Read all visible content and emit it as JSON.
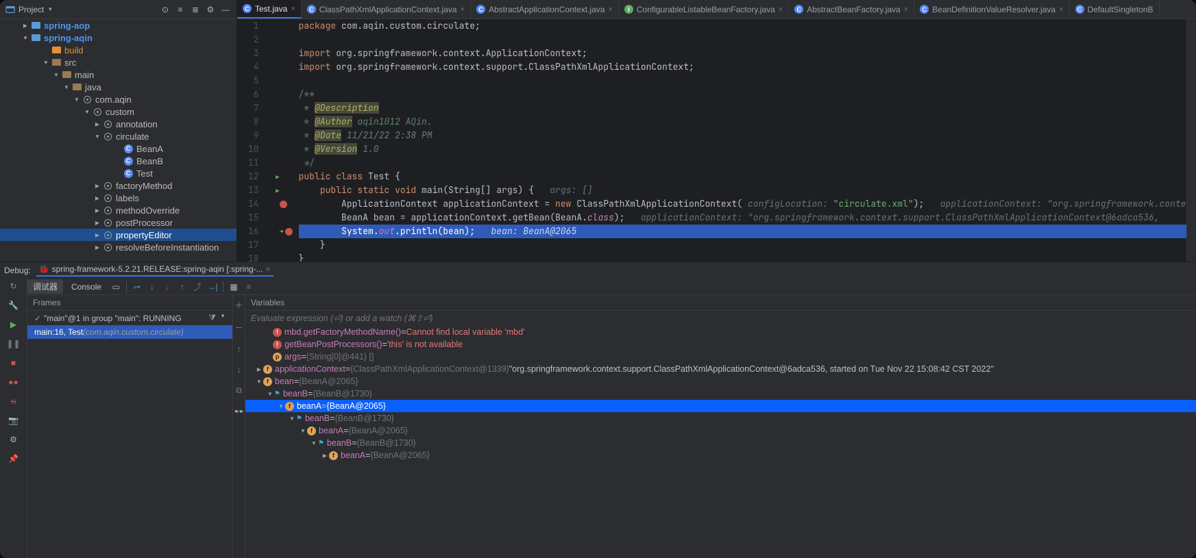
{
  "project": {
    "title": "Project",
    "tree": [
      {
        "indent": 30,
        "exp": "right",
        "icon": "module",
        "label": "spring-aop"
      },
      {
        "indent": 30,
        "exp": "down",
        "icon": "module",
        "label": "spring-aqin"
      },
      {
        "indent": 60,
        "exp": "",
        "icon": "build",
        "label": "build"
      },
      {
        "indent": 60,
        "exp": "down",
        "icon": "folder",
        "label": "src"
      },
      {
        "indent": 75,
        "exp": "down",
        "icon": "folder-src",
        "label": "main"
      },
      {
        "indent": 90,
        "exp": "down",
        "icon": "folder-src",
        "label": "java"
      },
      {
        "indent": 105,
        "exp": "down",
        "icon": "pkg",
        "label": "com.aqin"
      },
      {
        "indent": 120,
        "exp": "down",
        "icon": "pkg",
        "label": "custom"
      },
      {
        "indent": 135,
        "exp": "right",
        "icon": "pkg",
        "label": "annotation"
      },
      {
        "indent": 135,
        "exp": "down",
        "icon": "pkg",
        "label": "circulate"
      },
      {
        "indent": 165,
        "exp": "",
        "icon": "class",
        "label": "BeanA"
      },
      {
        "indent": 165,
        "exp": "",
        "icon": "class",
        "label": "BeanB"
      },
      {
        "indent": 165,
        "exp": "",
        "icon": "class",
        "label": "Test"
      },
      {
        "indent": 135,
        "exp": "right",
        "icon": "pkg",
        "label": "factoryMethod"
      },
      {
        "indent": 135,
        "exp": "right",
        "icon": "pkg",
        "label": "labels"
      },
      {
        "indent": 135,
        "exp": "right",
        "icon": "pkg",
        "label": "methodOverride"
      },
      {
        "indent": 135,
        "exp": "right",
        "icon": "pkg",
        "label": "postProcessor"
      },
      {
        "indent": 135,
        "exp": "right",
        "icon": "pkg",
        "label": "propertyEditor",
        "selected": true
      },
      {
        "indent": 135,
        "exp": "right",
        "icon": "pkg",
        "label": "resolveBeforeInstantiation"
      }
    ]
  },
  "tabs": [
    {
      "name": "Test.java",
      "active": true,
      "color": "#548af7"
    },
    {
      "name": "ClassPathXmlApplicationContext.java",
      "active": false,
      "color": "#548af7"
    },
    {
      "name": "AbstractApplicationContext.java",
      "active": false,
      "color": "#548af7"
    },
    {
      "name": "ConfigurableListableBeanFactory.java",
      "active": false,
      "color": "#5fad65"
    },
    {
      "name": "AbstractBeanFactory.java",
      "active": false,
      "color": "#548af7"
    },
    {
      "name": "BeanDefinitionValueResolver.java",
      "active": false,
      "color": "#548af7"
    },
    {
      "name": "DefaultSingletonB",
      "active": false,
      "color": "#548af7",
      "noclose": true
    }
  ],
  "editor": {
    "start_line": 1,
    "lines": [
      {
        "n": 1,
        "html": "<span class='kw'>package</span> <span class='pkg-txt'>com.aqin.custom.circulate;</span>"
      },
      {
        "n": 2,
        "html": ""
      },
      {
        "n": 3,
        "html": "<span class='kw'>import</span> <span class='pkg-txt'>org.springframework.context.ApplicationContext;</span>"
      },
      {
        "n": 4,
        "html": "<span class='kw'>import</span> <span class='pkg-txt'>org.springframework.context.support.ClassPathXmlApplicationContext;</span>"
      },
      {
        "n": 5,
        "html": ""
      },
      {
        "n": 6,
        "html": "<span class='doc-star'>/**</span>"
      },
      {
        "n": 7,
        "html": "<span class='doc-star'> * </span><span class='annot'>@Description</span>"
      },
      {
        "n": 8,
        "html": "<span class='doc-star'> * </span><span class='annot'>@Author</span><span class='doc'> aqin1012 AQin.</span>"
      },
      {
        "n": 9,
        "html": "<span class='doc-star'> * </span><span class='annot'>@Date</span><span class='doc'> 11/21/22 2:38 PM</span>"
      },
      {
        "n": 10,
        "html": "<span class='doc-star'> * </span><span class='annot'>@Version</span><span class='doc'> 1.0</span>"
      },
      {
        "n": 11,
        "html": "<span class='doc-star'> */</span>"
      },
      {
        "n": 12,
        "run": true,
        "html": "<span class='kw'>public class</span> <span class='type'>Test</span> <span class='paren'>{</span>"
      },
      {
        "n": 13,
        "run": true,
        "html": "    <span class='kw'>public static void</span> <span class='method'>main</span><span class='paren'>(</span><span class='type'>String</span><span class='paren'>[]</span> args<span class='paren'>) {</span>   <span class='hint'>args: []</span>"
      },
      {
        "n": 14,
        "bp": true,
        "html": "        <span class='type'>ApplicationContext</span> applicationContext = <span class='kw'>new</span> <span class='type'>ClassPathXmlApplicationContext</span><span class='paren'>(</span> <span class='hint'>configLocation:</span> <span class='str'>&quot;circulate.xml&quot;</span><span class='paren'>);</span>   <span class='hint'>applicationContext: &quot;org.springframework.conte</span>"
      },
      {
        "n": 15,
        "html": "        <span class='type'>BeanA</span> bean = applicationContext.<span class='method'>getBean</span><span class='paren'>(</span>BeanA.<span class='field'>class</span><span class='paren'>);</span>   <span class='hint'>applicationContext: &quot;org.springframework.context.support.ClassPathXmlApplicationContext@6adca536,</span>"
      },
      {
        "n": 16,
        "exec": true,
        "bp": true,
        "arrow": true,
        "html": "        <span style='color:#fff'>System.</span><span class='field'>out</span><span style='color:#fff'>.println(bean);</span>   <span class='hint' style='color:#c5d8ff'>bean: BeanA@2065</span>"
      },
      {
        "n": 17,
        "html": "    <span class='paren'>}</span>"
      },
      {
        "n": 18,
        "html": "<span class='paren'>}</span>"
      }
    ]
  },
  "debug": {
    "label": "Debug:",
    "config": "spring-framework-5.2.21.RELEASE:spring-aqin [:spring-...",
    "left_tabs": {
      "a": "调试器",
      "b": "Console"
    },
    "frames_header": "Frames",
    "thread": "\"main\"@1 in group \"main\": RUNNING",
    "frame_sel_method": "main:16, Test ",
    "frame_sel_loc": "(com.aqin.custom.circulate)",
    "vars_header": "Variables",
    "eval_placeholder": "Evaluate expression (⏎) or add a watch (⌘⇧⏎)",
    "vars": [
      {
        "indent": 28,
        "exp": "",
        "badge": "e",
        "name": "mbd.getFactoryMethodName()",
        "eq": " = ",
        "val": "Cannot find local variable 'mbd'",
        "err": true
      },
      {
        "indent": 28,
        "exp": "",
        "badge": "e",
        "name": "getBeanPostProcessors()",
        "eq": " = ",
        "val": "'this' is not available",
        "err": true
      },
      {
        "indent": 28,
        "exp": "",
        "badge": "p",
        "name": "args",
        "eq": " = ",
        "val": "{String[0]@441} []"
      },
      {
        "indent": 14,
        "exp": "right",
        "badge": "f",
        "name": "applicationContext",
        "eq": " = ",
        "val": "{ClassPathXmlApplicationContext@1339}",
        "tail": " \"org.springframework.context.support.ClassPathXmlApplicationContext@6adca536, started on Tue Nov 22 15:08:42 CST 2022\""
      },
      {
        "indent": 14,
        "exp": "down",
        "badge": "f",
        "name": "bean",
        "eq": " = ",
        "val": "{BeanA@2065}"
      },
      {
        "indent": 30,
        "exp": "down",
        "flag": true,
        "name": "beanB",
        "eq": " = ",
        "val": "{BeanB@1730}"
      },
      {
        "indent": 46,
        "exp": "down",
        "badge": "f",
        "name": "beanA",
        "eq": " = ",
        "val": "{BeanA@2065}",
        "hi": true
      },
      {
        "indent": 62,
        "exp": "down",
        "flag": true,
        "name": "beanB",
        "eq": " = ",
        "val": "{BeanB@1730}"
      },
      {
        "indent": 78,
        "exp": "down",
        "badge": "f",
        "name": "beanA",
        "eq": " = ",
        "val": "{BeanA@2065}"
      },
      {
        "indent": 94,
        "exp": "down",
        "flag": true,
        "name": "beanB",
        "eq": " = ",
        "val": "{BeanB@1730}"
      },
      {
        "indent": 110,
        "exp": "right",
        "badge": "f",
        "name": "beanA",
        "eq": " = ",
        "val": "{BeanA@2065}"
      }
    ]
  }
}
